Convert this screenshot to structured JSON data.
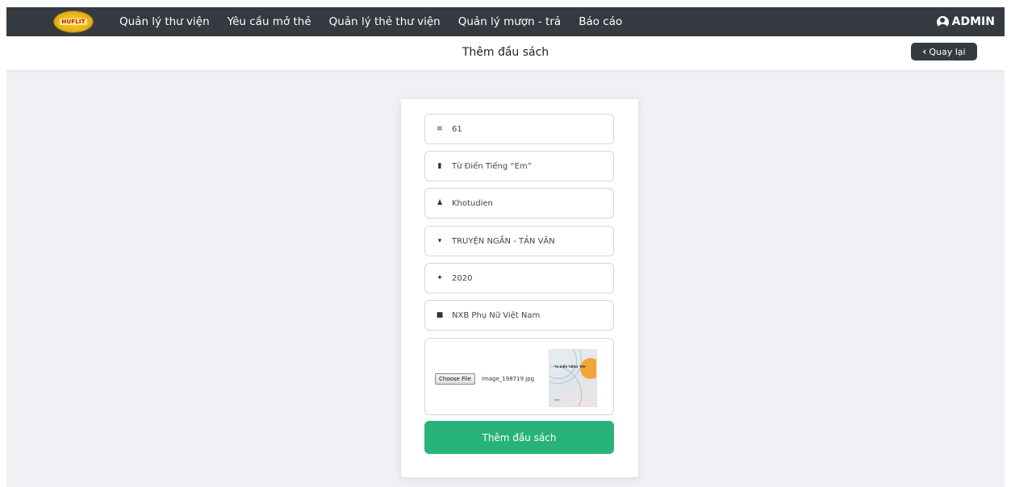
{
  "navbar": {
    "logo_text": "HUFLIT",
    "links": [
      {
        "label": "Quản lý thư viện"
      },
      {
        "label": "Yêu cầu mở thẻ"
      },
      {
        "label": "Quản lý thẻ thư viện"
      },
      {
        "label": "Quản lý mượn - trả"
      },
      {
        "label": "Báo cáo"
      }
    ],
    "admin_label": "ADMIN"
  },
  "header": {
    "title": "Thêm đầu sách",
    "back_label": "Quay lại"
  },
  "form": {
    "fields": [
      {
        "icon": "list-icon",
        "value": "61"
      },
      {
        "icon": "book-icon",
        "value": "Từ Điển Tiếng “Em”"
      },
      {
        "icon": "user-pen-icon",
        "value": "Khotudien"
      },
      {
        "icon": "caret-down-icon",
        "value": "TRUYỆN NGẮN - TẢN VĂN"
      },
      {
        "icon": "feather-icon",
        "value": "2020"
      },
      {
        "icon": "industry-icon",
        "value": "NXB Phụ Nữ Việt Nam"
      }
    ],
    "file": {
      "button_label": "Choose File",
      "file_name": "image_198719.jpg",
      "cover_title": "TỪ ĐIỂN TIẾNG \"EM\"",
      "cover_publisher": "NXB"
    },
    "submit_label": "Thêm đầu sách"
  }
}
